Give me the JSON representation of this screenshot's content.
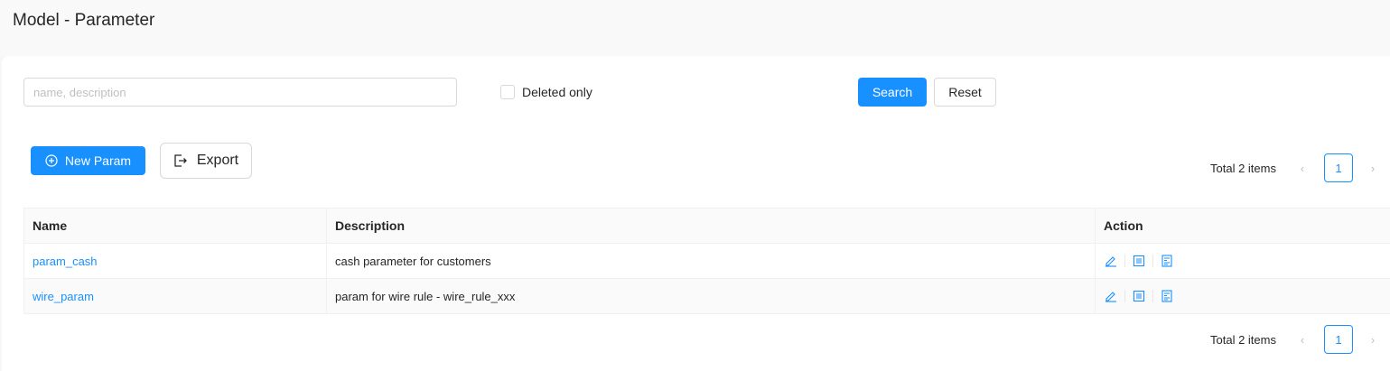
{
  "header": {
    "title": "Model - Parameter"
  },
  "filters": {
    "search_placeholder": "name, description",
    "search_value": "",
    "deleted_only_label": "Deleted only",
    "deleted_only_checked": false,
    "search_button": "Search",
    "reset_button": "Reset"
  },
  "toolbar": {
    "new_button": "New Param",
    "new_icon": "plus-circle-icon",
    "export_button": "Export",
    "export_icon": "export-icon"
  },
  "pagination": {
    "total_text": "Total 2 items",
    "current_page": "1",
    "prev_icon": "chevron-left-icon",
    "next_icon": "chevron-right-icon"
  },
  "table": {
    "columns": [
      "Name",
      "Description",
      "Action"
    ],
    "rows": [
      {
        "name": "param_cash",
        "description": "cash parameter for customers"
      },
      {
        "name": "wire_param",
        "description": "param for wire rule - wire_rule_xxx"
      }
    ],
    "action_icons": [
      "edit-icon",
      "details-icon",
      "history-icon"
    ]
  },
  "colors": {
    "primary": "#1890ff",
    "border": "#d9d9d9",
    "header_bg": "#fafafa"
  }
}
